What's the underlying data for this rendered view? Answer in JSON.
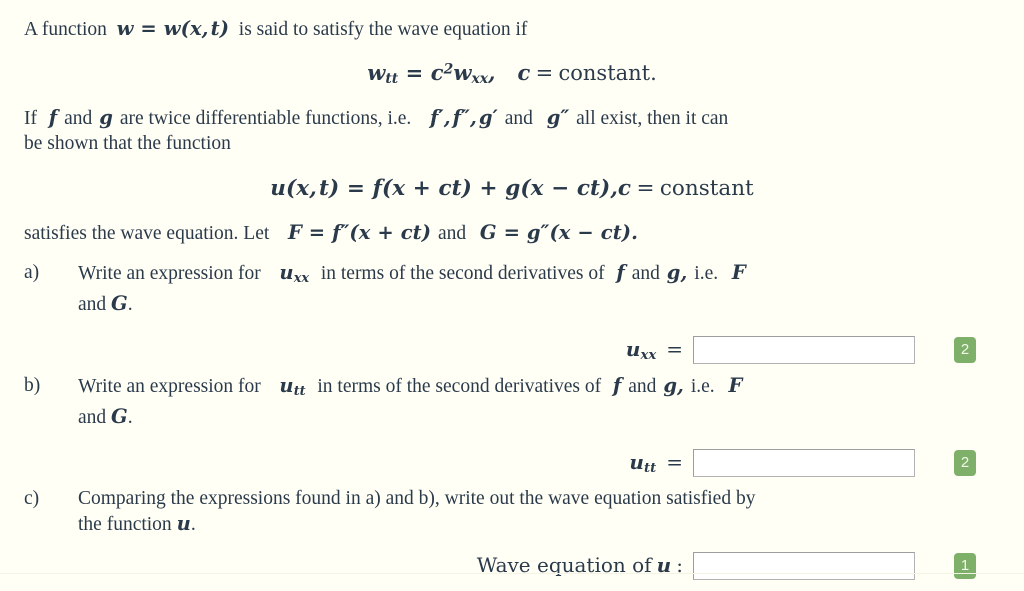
{
  "document": {
    "background_color": "#FFFFF5",
    "text_color": "#2B3A4B",
    "badge_color": "#7FB069"
  },
  "intro": {
    "line1_prefix": "A function",
    "line1_math": "w = w(x, t)",
    "line1_suffix": "is said to satisfy the wave equation if",
    "equation1": "w_tt = c^2 w_xx,   c = constant.",
    "line2_a": "If",
    "line2_f": "f",
    "line2_and": "and",
    "line2_g": "g",
    "line2_b": "are twice differentiable functions, i.e.",
    "line2_derivs": "f', f'', g'",
    "line2_and2": "and",
    "line2_gpp": "g''",
    "line2_c": "all exist, then it can",
    "line3": "be shown that the function",
    "equation2": "u(x, t) = f(x + ct) + g(x - ct),   c = constant",
    "line4_a": "satisfies the wave equation. Let",
    "line4_F": "F = f''(x + ct)",
    "line4_and": "and",
    "line4_G": "G = g''(x - ct)."
  },
  "questions": [
    {
      "label": "a)",
      "text_start": "Write an expression for",
      "variable": "u_xx",
      "text_mid": "in terms of the second derivatives of",
      "f": "f",
      "and": "and",
      "g": "g,",
      "ie": "i.e.",
      "F": "F",
      "text_end_line2": "and G.",
      "answer": {
        "label": "u_xx  =",
        "value": "",
        "placeholder": "",
        "marks": "2"
      }
    },
    {
      "label": "b)",
      "text_start": "Write an expression for",
      "variable": "u_tt",
      "text_mid": "in terms of the second derivatives of",
      "f": "f",
      "and": "and",
      "g": "g,",
      "ie": "i.e.",
      "F": "F",
      "text_end_line2": "and G.",
      "answer": {
        "label": "u_tt  =",
        "value": "",
        "placeholder": "",
        "marks": "2"
      }
    },
    {
      "label": "c)",
      "text_line1": "Comparing the expressions found in a) and b), write out the wave equation satisfied by",
      "text_line2_start": "the function",
      "text_line2_var": "u",
      "text_line2_end": ".",
      "answer": {
        "label": "Wave equation of  u  :",
        "value": "",
        "placeholder": "",
        "marks": "1"
      }
    }
  ]
}
